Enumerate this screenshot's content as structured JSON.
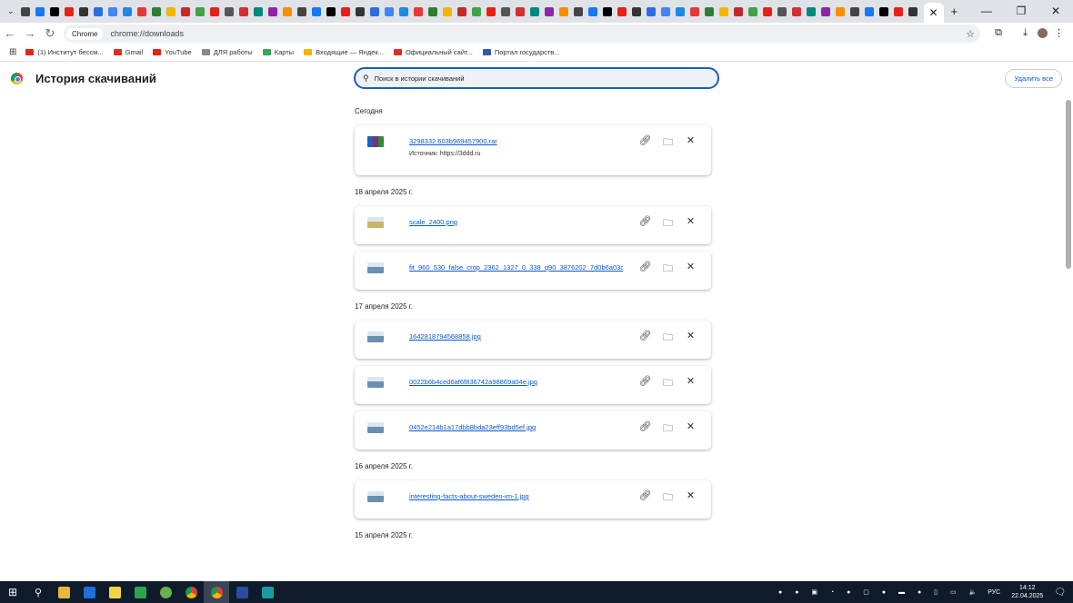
{
  "browser": {
    "chip_label": "Chrome",
    "url": "chrome://downloads",
    "new_tab": "+",
    "minimize": "—",
    "maximize": "❐",
    "close": "✕",
    "tab_close": "✕"
  },
  "bookmarks": [
    {
      "label": "(1) Институт бессм...",
      "color": "#e62117"
    },
    {
      "label": "Gmail",
      "color": "#d93025"
    },
    {
      "label": "YouTube",
      "color": "#e62117"
    },
    {
      "label": "ДЛЯ работы",
      "color": "#888888"
    },
    {
      "label": "Карты",
      "color": "#34a853"
    },
    {
      "label": "Входящие — Яндек...",
      "color": "#f4b400"
    },
    {
      "label": "Официальный сайт...",
      "color": "#d93025"
    },
    {
      "label": "Портал государств...",
      "color": "#3355aa"
    }
  ],
  "page": {
    "title": "История скачиваний",
    "search_placeholder": "Поиск в истории скачиваний",
    "clear_all": "Удалить все"
  },
  "groups": [
    {
      "date": "Сегодня",
      "items": [
        {
          "name": "3298332.603b969457900.rar",
          "source": "Источник: https://3ddd.ru",
          "icon": "archive",
          "color": "#8b2a6e"
        }
      ]
    },
    {
      "date": "18 апреля 2025 г.",
      "items": [
        {
          "name": "scale_2400.png",
          "icon": "image",
          "color": "#c9b56a"
        },
        {
          "name": "fit_960_530_false_crop_2362_1327_0_338_q90_3876202_7d0b6a03c...",
          "icon": "image",
          "color": "#6b8fb0"
        }
      ]
    },
    {
      "date": "17 апреля 2025 г.",
      "items": [
        {
          "name": "1642818794568858.jpg",
          "icon": "image",
          "color": "#6b8fb0"
        },
        {
          "name": "0022b6b4ced6af6f836742a98869a04e.jpg",
          "icon": "image",
          "color": "#6b8fb0"
        },
        {
          "name": "0452e214b1a17dbb8bda23eff93bd5ef.jpg",
          "icon": "image",
          "color": "#6b8fb0"
        }
      ]
    },
    {
      "date": "16 апреля 2025 г.",
      "items": [
        {
          "name": "interesting-facts-about-sweden-im-1.jpg",
          "icon": "image",
          "color": "#6b8fb0"
        }
      ]
    },
    {
      "date": "15 апреля 2025 г.",
      "items": []
    }
  ],
  "taskbar": {
    "language": "РУС",
    "time": "14:12",
    "date": "22.04.2025"
  }
}
